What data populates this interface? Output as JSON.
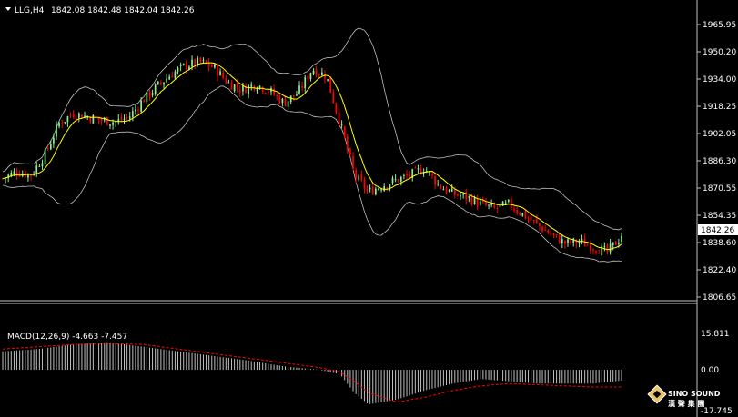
{
  "header": {
    "symbol_label": "LLG,H4",
    "ohlc_label": "1842.08 1842.48 1842.04 1842.26"
  },
  "macd": {
    "label": "MACD(12,26,9) -4.663 -7.457",
    "axis_ticks": [
      "15.811",
      "0.00",
      "-17.745"
    ]
  },
  "price_axis": {
    "ticks": [
      "1965.95",
      "1950.20",
      "1934.00",
      "1918.25",
      "1902.05",
      "1886.30",
      "1870.55",
      "1854.35",
      "1838.60",
      "1822.40",
      "1806.65"
    ],
    "current_price_label": "1842.26"
  },
  "logo": {
    "text": "SINO SOUND",
    "subtext": "漢 聲 集 團"
  },
  "colors": {
    "background": "#000000",
    "bull_candle": "#90EE90",
    "bear_candle": "#FF0000",
    "moving_average": "#FFFF00",
    "bollinger_bands": "#C0C0C0",
    "macd_histogram": "#C0C0C0",
    "macd_signal": "#FF0000",
    "grid_lines": "#C0C0C0"
  },
  "chart_data": [
    {
      "type": "candlestick",
      "indicators": [
        "moving average",
        "bollinger bands"
      ],
      "ylim": [
        1806.65,
        1965.95
      ],
      "close_points": [
        [
          0,
          1876
        ],
        [
          10,
          1880
        ],
        [
          20,
          1878
        ],
        [
          30,
          1890
        ],
        [
          40,
          1908
        ],
        [
          50,
          1914
        ],
        [
          60,
          1912
        ],
        [
          70,
          1910
        ],
        [
          80,
          1909
        ],
        [
          90,
          1912
        ],
        [
          100,
          1922
        ],
        [
          110,
          1930
        ],
        [
          120,
          1937
        ],
        [
          130,
          1942
        ],
        [
          140,
          1944
        ],
        [
          150,
          1941
        ],
        [
          160,
          1932
        ],
        [
          170,
          1928
        ],
        [
          180,
          1931
        ],
        [
          190,
          1927
        ],
        [
          200,
          1920
        ],
        [
          210,
          1926
        ],
        [
          220,
          1940
        ],
        [
          230,
          1936
        ],
        [
          240,
          1908
        ],
        [
          250,
          1878
        ],
        [
          260,
          1868
        ],
        [
          270,
          1872
        ],
        [
          280,
          1875
        ],
        [
          290,
          1878
        ],
        [
          300,
          1882
        ],
        [
          310,
          1872
        ],
        [
          320,
          1867
        ],
        [
          330,
          1865
        ],
        [
          340,
          1861
        ],
        [
          350,
          1858
        ],
        [
          360,
          1861
        ],
        [
          370,
          1855
        ],
        [
          380,
          1849
        ],
        [
          390,
          1843
        ],
        [
          400,
          1838
        ],
        [
          410,
          1839
        ],
        [
          420,
          1836
        ],
        [
          430,
          1833
        ],
        [
          440,
          1842.26
        ]
      ]
    },
    {
      "type": "bar",
      "title": "MACD(12,26,9) -4.663 -7.457",
      "series": [
        {
          "name": "MACD",
          "values": [
            [
              0,
              8
            ],
            [
              25,
              9
            ],
            [
              50,
              11
            ],
            [
              75,
              12
            ],
            [
              100,
              10
            ],
            [
              125,
              8
            ],
            [
              150,
              6
            ],
            [
              175,
              4
            ],
            [
              200,
              1.5
            ],
            [
              225,
              0
            ],
            [
              240,
              -2
            ],
            [
              250,
              -10
            ],
            [
              260,
              -15
            ],
            [
              280,
              -13
            ],
            [
              300,
              -9
            ],
            [
              320,
              -6
            ],
            [
              340,
              -4
            ],
            [
              360,
              -5
            ],
            [
              380,
              -6
            ],
            [
              400,
              -6
            ],
            [
              420,
              -6
            ],
            [
              440,
              -4.663
            ]
          ]
        },
        {
          "name": "Signal",
          "values": [
            [
              0,
              9
            ],
            [
              25,
              10
            ],
            [
              50,
              11
            ],
            [
              75,
              11.5
            ],
            [
              100,
              11
            ],
            [
              125,
              9
            ],
            [
              150,
              7
            ],
            [
              175,
              5
            ],
            [
              200,
              3
            ],
            [
              225,
              1
            ],
            [
              240,
              -1
            ],
            [
              250,
              -5
            ],
            [
              260,
              -10
            ],
            [
              280,
              -14
            ],
            [
              300,
              -12
            ],
            [
              320,
              -9
            ],
            [
              340,
              -7
            ],
            [
              360,
              -6
            ],
            [
              380,
              -6.5
            ],
            [
              400,
              -7
            ],
            [
              420,
              -7.5
            ],
            [
              440,
              -7.457
            ]
          ]
        }
      ],
      "ylim": [
        -17.745,
        15.811
      ]
    }
  ]
}
